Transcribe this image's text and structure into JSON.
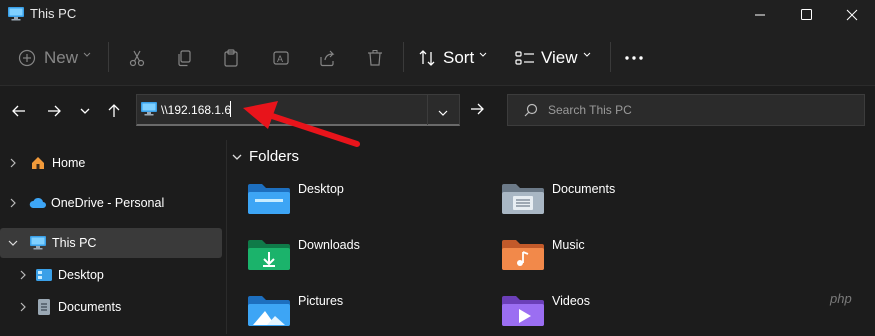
{
  "window": {
    "title": "This PC",
    "controls": {
      "minimize": "minimize-icon",
      "maximize": "maximize-icon",
      "close": "close-icon"
    }
  },
  "toolbar": {
    "new_label": "New",
    "sort_label": "Sort",
    "view_label": "View",
    "icons": [
      "cut-icon",
      "copy-icon",
      "paste-icon",
      "rename-icon",
      "share-icon",
      "delete-icon",
      "more-icon"
    ]
  },
  "address": {
    "value": "\\\\192.168.1.6",
    "search_placeholder": "Search This PC"
  },
  "sidebar": {
    "items": [
      {
        "label": "Home"
      },
      {
        "label": "OneDrive - Personal"
      },
      {
        "label": "This PC"
      },
      {
        "label": "Desktop"
      },
      {
        "label": "Documents"
      }
    ]
  },
  "content": {
    "section_label": "Folders",
    "folders": [
      {
        "label": "Desktop"
      },
      {
        "label": "Documents"
      },
      {
        "label": "Downloads"
      },
      {
        "label": "Music"
      },
      {
        "label": "Pictures"
      },
      {
        "label": "Videos"
      }
    ]
  },
  "watermark": "php",
  "colors": {
    "background": "#1c1c1c",
    "accent_blue": "#3da5f5",
    "arrow_red": "#e8141b",
    "downloads_green": "#1bb36b"
  }
}
